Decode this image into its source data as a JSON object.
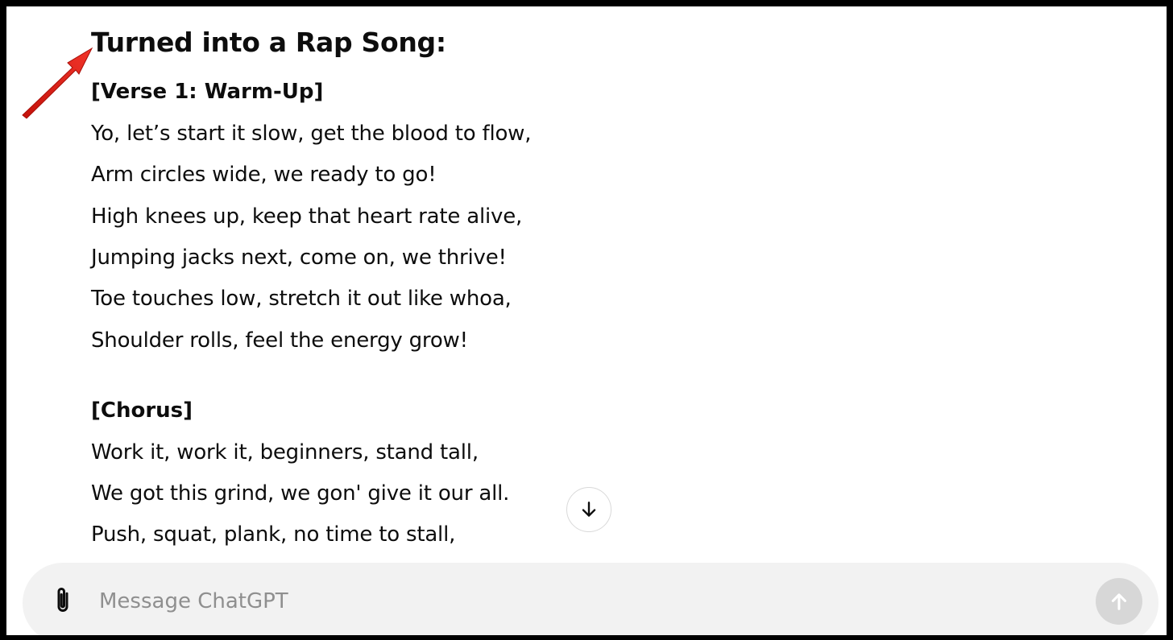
{
  "response": {
    "heading": "Turned into a Rap Song:",
    "sections": [
      {
        "label": "[Verse 1: Warm-Up]",
        "lines": [
          "Yo, let’s start it slow, get the blood to flow,",
          "Arm circles wide, we ready to go!",
          "High knees up, keep that heart rate alive,",
          "Jumping jacks next, come on, we thrive!",
          "Toe touches low, stretch it out like whoa,",
          "Shoulder rolls, feel the energy grow!"
        ]
      },
      {
        "label": "[Chorus]",
        "lines": [
          "Work it, work it, beginners, stand tall,",
          "We got this grind, we gon' give it our all.",
          "Push, squat, plank, no time to stall,"
        ]
      }
    ]
  },
  "scroll_button": {
    "icon": "arrow-down-icon"
  },
  "composer": {
    "placeholder": "Message ChatGPT",
    "value": "",
    "attach_icon": "paperclip-icon",
    "send_icon": "arrow-up-icon"
  },
  "colors": {
    "frame_border": "#000000",
    "composer_bg": "#f2f2f2",
    "send_disabled": "#d7d7d7",
    "annotation_arrow": "#e8231a"
  }
}
